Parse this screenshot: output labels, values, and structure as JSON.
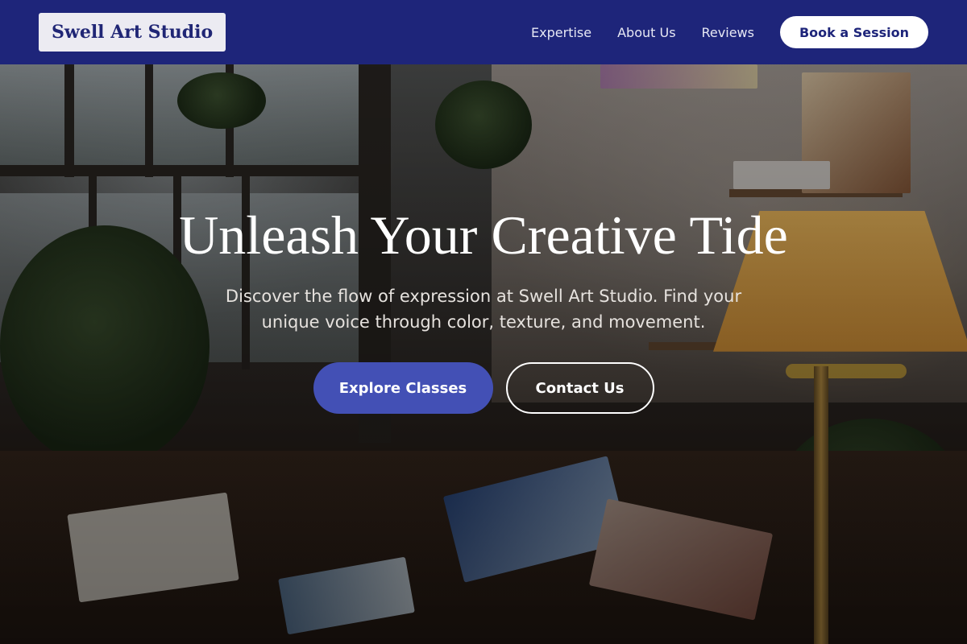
{
  "nav": {
    "brand": "Swell Art Studio",
    "links": [
      {
        "label": "Expertise"
      },
      {
        "label": "About Us"
      },
      {
        "label": "Reviews"
      }
    ],
    "cta": "Book a Session"
  },
  "hero": {
    "title": "Unleash Your Creative Tide",
    "subtitle": "Discover the flow of expression at Swell Art Studio. Find your unique voice through color, texture, and movement.",
    "primary_button": "Explore Classes",
    "secondary_button": "Contact Us"
  },
  "colors": {
    "nav_background": "#1e257a",
    "brand_text": "#202675",
    "primary_button": "#4350b5",
    "white": "#ffffff"
  },
  "background_image": "art-studio-photo"
}
